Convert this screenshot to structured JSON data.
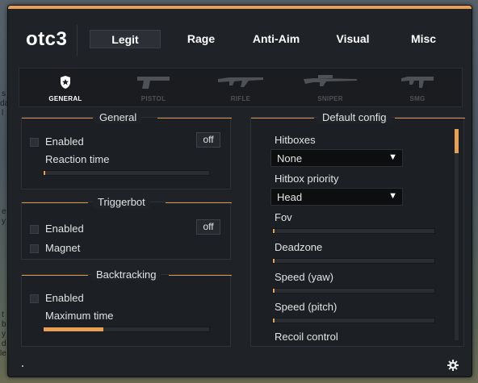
{
  "app": {
    "logo": "otc3"
  },
  "tabs": [
    {
      "label": "Legit",
      "active": true
    },
    {
      "label": "Rage",
      "active": false
    },
    {
      "label": "Anti-Aim",
      "active": false
    },
    {
      "label": "Visual",
      "active": false
    },
    {
      "label": "Misc",
      "active": false
    }
  ],
  "weapons": [
    {
      "label": "GENERAL",
      "icon": "shield-icon",
      "active": true
    },
    {
      "label": "PISTOL",
      "icon": "pistol-icon",
      "active": false
    },
    {
      "label": "RIFLE",
      "icon": "rifle-icon",
      "active": false
    },
    {
      "label": "SNIPER",
      "icon": "sniper-icon",
      "active": false
    },
    {
      "label": "SMG",
      "icon": "smg-icon",
      "active": false
    }
  ],
  "general": {
    "title": "General",
    "enabled_label": "Enabled",
    "enabled_checked": false,
    "key_label": "off",
    "reaction_label": "Reaction time",
    "reaction_value": 0.0
  },
  "triggerbot": {
    "title": "Triggerbot",
    "enabled_label": "Enabled",
    "enabled_checked": false,
    "key_label": "off",
    "magnet_label": "Magnet",
    "magnet_checked": false
  },
  "backtracking": {
    "title": "Backtracking",
    "enabled_label": "Enabled",
    "enabled_checked": false,
    "max_time_label": "Maximum time",
    "max_time_value": 0.36
  },
  "default_config": {
    "title": "Default config",
    "hitboxes_label": "Hitboxes",
    "hitboxes_value": "None",
    "hitbox_priority_label": "Hitbox priority",
    "hitbox_priority_value": "Head",
    "fov_label": "Fov",
    "fov_value": 0.0,
    "deadzone_label": "Deadzone",
    "deadzone_value": 0.0,
    "speed_yaw_label": "Speed (yaw)",
    "speed_yaw_value": 0.0,
    "speed_pitch_label": "Speed (pitch)",
    "speed_pitch_value": 0.0,
    "recoil_label": "Recoil control"
  },
  "background_text": [
    "s",
    "da",
    "l",
    "e",
    "y",
    "t",
    "b",
    "y",
    "d",
    "le"
  ],
  "colors": {
    "accent": "#e8a052",
    "panel": "#1f2226"
  }
}
